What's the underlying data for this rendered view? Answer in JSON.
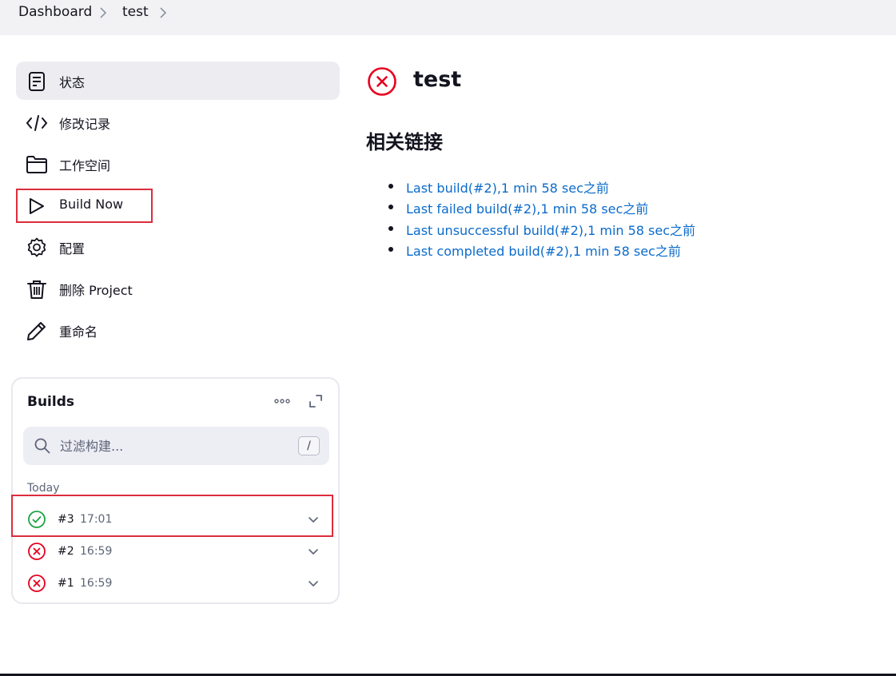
{
  "breadcrumb": {
    "items": [
      "Dashboard",
      "test"
    ]
  },
  "side_panel": {
    "tasks": [
      {
        "label": "状态",
        "icon": "document-icon"
      },
      {
        "label": "修改记录",
        "icon": "code-icon"
      },
      {
        "label": "工作空间",
        "icon": "folder-icon"
      },
      {
        "label": "Build Now",
        "icon": "play-icon"
      },
      {
        "label": "配置",
        "icon": "gear-icon"
      },
      {
        "label": "删除 Project",
        "icon": "trash-icon"
      },
      {
        "label": "重命名",
        "icon": "pencil-icon"
      }
    ]
  },
  "builds": {
    "title": "Builds",
    "filter_placeholder": "过滤构建...",
    "shortcut": "/",
    "group_label": "Today",
    "items": [
      {
        "number": "#3",
        "time": "17:01",
        "status": "success"
      },
      {
        "number": "#2",
        "time": "16:59",
        "status": "failed"
      },
      {
        "number": "#1",
        "time": "16:59",
        "status": "failed"
      }
    ]
  },
  "job": {
    "title": "test",
    "status": "failed"
  },
  "permalinks": {
    "title": "相关链接",
    "links": [
      "Last build(#2),1 min 58 sec之前",
      "Last failed build(#2),1 min 58 sec之前",
      "Last unsuccessful build(#2),1 min 58 sec之前",
      "Last completed build(#2),1 min 58 sec之前"
    ]
  },
  "colors": {
    "failed": "#e6001f",
    "success": "#1ea446",
    "link": "#0b6bcb",
    "highlight_box": "#dc2d3c"
  }
}
